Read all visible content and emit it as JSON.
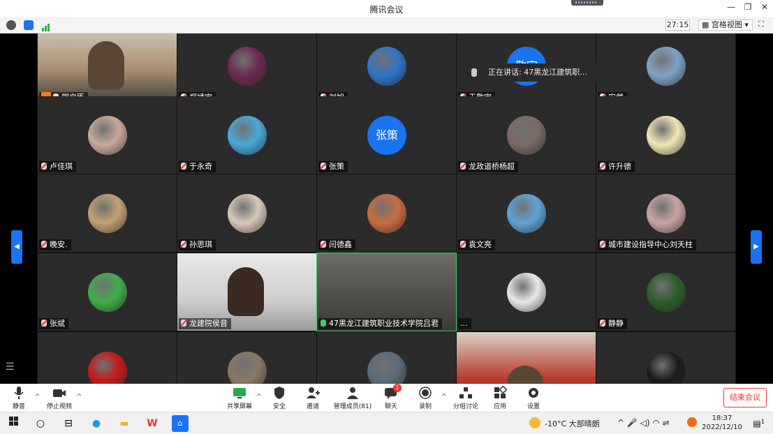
{
  "window": {
    "title": "腾讯会议"
  },
  "infobar": {
    "timer": "27:15",
    "view_label": "宫格视图"
  },
  "speaker_popup": {
    "text": "正在讲话: 47黑龙江建筑职..."
  },
  "participants": [
    {
      "name": "郭启臣",
      "type": "video",
      "host": true
    },
    {
      "name": "郑靖宇",
      "type": "avatar",
      "color": "#6b2a55"
    },
    {
      "name": "刘旭",
      "type": "avatar",
      "color": "#2f74c7"
    },
    {
      "name": "于敬宇",
      "type": "text",
      "text": "敬宇"
    },
    {
      "name": "安然",
      "type": "avatar",
      "color": "#7fa3c7"
    },
    {
      "name": "卢佳琪",
      "type": "avatar",
      "color": "#c9a99a"
    },
    {
      "name": "于永奇",
      "type": "avatar",
      "color": "#48a8d8"
    },
    {
      "name": "张策",
      "type": "text",
      "text": "张策"
    },
    {
      "name": "龙政道桥杨超",
      "type": "avatar",
      "color": "#7a6a66"
    },
    {
      "name": "许升德",
      "type": "avatar",
      "color": "#f0e6b4"
    },
    {
      "name": "晚安.",
      "type": "avatar",
      "color": "#c2a172"
    },
    {
      "name": "孙思琪",
      "type": "avatar",
      "color": "#d8c8b8"
    },
    {
      "name": "闫德鑫",
      "type": "avatar",
      "color": "#c76d3f"
    },
    {
      "name": "袁文亮",
      "type": "avatar",
      "color": "#5ea3d6"
    },
    {
      "name": "城市建设指导中心刘天柱",
      "type": "avatar",
      "color": "#c8a4a4"
    },
    {
      "name": "张斌",
      "type": "avatar",
      "color": "#3fae4a"
    },
    {
      "name": "龙建院侯音",
      "type": "video"
    },
    {
      "name": "47黑龙江建筑职业技术学院吕君",
      "type": "video",
      "speaking": true
    },
    {
      "name": "...",
      "type": "avatar",
      "color": "#e8e8e8"
    },
    {
      "name": "静静",
      "type": "avatar",
      "color": "#2c5e2c"
    },
    {
      "name": "",
      "type": "avatar",
      "color": "#c41a1a"
    },
    {
      "name": "",
      "type": "avatar",
      "color": "#8a7766"
    },
    {
      "name": "",
      "type": "avatar",
      "color": "#5a6b7a"
    },
    {
      "name": "",
      "type": "video"
    },
    {
      "name": "",
      "type": "avatar",
      "color": "#1c1c1c"
    }
  ],
  "toolbar": {
    "mute": "静音",
    "stop_video": "停止视频",
    "share_screen": "共享屏幕",
    "security": "安全",
    "invite": "邀请",
    "members": "管理成员(81)",
    "chat": "聊天",
    "chat_badge": "1",
    "record": "录制",
    "breakout": "分组讨论",
    "apps": "应用",
    "settings": "设置",
    "end_meeting": "结束会议"
  },
  "taskbar": {
    "weather": "-10°C 大部晴朗",
    "time": "18:37",
    "date": "2022/12/10",
    "notification_count": "1"
  }
}
